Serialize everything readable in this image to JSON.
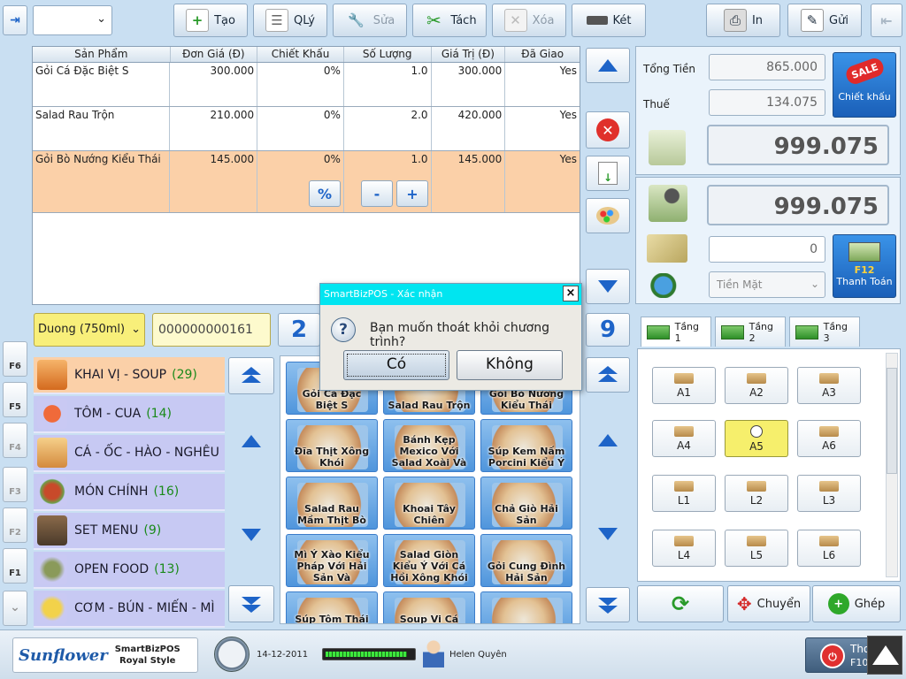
{
  "toolbar": {
    "create": "Tạo",
    "manage": "QLý",
    "edit": "Sửa",
    "split": "Tách",
    "delete": "Xóa",
    "drawer": "Két",
    "print": "In",
    "send": "Gửi"
  },
  "order": {
    "columns": [
      "Sản Phẩm",
      "Đơn Giá (Đ)",
      "Chiết Khấu",
      "Số Lượng",
      "Giá Trị (Đ)",
      "Đã Giao"
    ],
    "rows": [
      {
        "product": "Gỏi Cá Đặc Biệt S",
        "price": "300.000",
        "discount": "0%",
        "qty": "1.0",
        "value": "300.000",
        "delivered": "Yes"
      },
      {
        "product": "Salad Rau Trộn",
        "price": "210.000",
        "discount": "0%",
        "qty": "2.0",
        "value": "420.000",
        "delivered": "Yes"
      },
      {
        "product": "Gỏi Bò Nướng Kiểu Thái",
        "price": "145.000",
        "discount": "0%",
        "qty": "1.0",
        "value": "145.000",
        "delivered": "Yes"
      }
    ],
    "percent_btn": "%",
    "minus_btn": "-",
    "plus_btn": "+"
  },
  "totals": {
    "total_label": "Tổng Tiền",
    "total_value": "865.000",
    "tax_label": "Thuế",
    "tax_value": "134.075",
    "grand_total": "999.075",
    "paid_total": "999.075",
    "cash_input": "0",
    "payment_method": "Tiền Mặt",
    "discount_btn": "Chiết khấu",
    "discount_badge": "SALE",
    "pay_key": "F12",
    "pay_btn": "Thanh Toán"
  },
  "filters": {
    "product_select": "Duong (750ml)",
    "barcode": "000000000161",
    "page_left": "2",
    "page_right": "9"
  },
  "categories": [
    {
      "name": "KHAI VỊ - SOUP",
      "count": "(29)"
    },
    {
      "name": "TÔM - CUA",
      "count": "(14)"
    },
    {
      "name": "CÁ - ỐC - HÀO - NGHÊU",
      "count": ""
    },
    {
      "name": "MÓN CHÍNH",
      "count": "(16)"
    },
    {
      "name": "SET MENU",
      "count": "(9)"
    },
    {
      "name": "OPEN FOOD",
      "count": "(13)"
    },
    {
      "name": "CƠM - BÚN - MIẾN - MÌ",
      "count": ""
    }
  ],
  "products": [
    "Gỏi Cá Đặc Biệt S",
    "Salad Rau Trộn",
    "Gỏi Bò Nướng Kiểu Thái",
    "Đĩa Thịt Xông Khói",
    "Bánh Kẹp Mexico Với Salad Xoài Và",
    "Súp Kem Nấm Porcini Kiểu Ý",
    "Salad Rau Mầm Thịt Bò",
    "Khoai Tây Chiên",
    "Chả Giò Hải Sản",
    "Mì Ý Xào Kiểu Pháp Với Hải Sản Và",
    "Salad Giòn Kiểu Ý Với Cá Hồi Xông Khói",
    "Gỏi Cung Đình Hải Sản",
    "Súp Tôm Thái",
    "Soup Vi Cá",
    ""
  ],
  "floors": [
    "Tầng 1",
    "Tầng 2",
    "Tầng 3"
  ],
  "tables": [
    "A1",
    "A2",
    "A3",
    "A4",
    "A5",
    "A6",
    "L1",
    "L2",
    "L3",
    "L4",
    "L5",
    "L6"
  ],
  "table_actions": {
    "move": "Chuyển",
    "merge": "Ghép"
  },
  "fkeys": [
    "F6",
    "F5",
    "F4",
    "F3",
    "F2",
    "F1"
  ],
  "dialog": {
    "title": "SmartBizPOS - Xác nhận",
    "message": "Bạn muốn thoát khỏi chương trình?",
    "yes": "Có",
    "no": "Không",
    "close": "×"
  },
  "footer": {
    "brand": "Sunflower",
    "product_line1": "SmartBizPOS",
    "product_line2": "Royal Style",
    "date": "14-12-2011",
    "user": "Helen Quyên",
    "exit": "Thoát",
    "exit_key": "F10"
  },
  "colors": {
    "accent": "#1e64c8",
    "selected_row": "#fbd0a8",
    "category_bg": "#c7c9f3",
    "selected_table": "#f6ef6c",
    "dialog_title": "#00e5f0"
  }
}
